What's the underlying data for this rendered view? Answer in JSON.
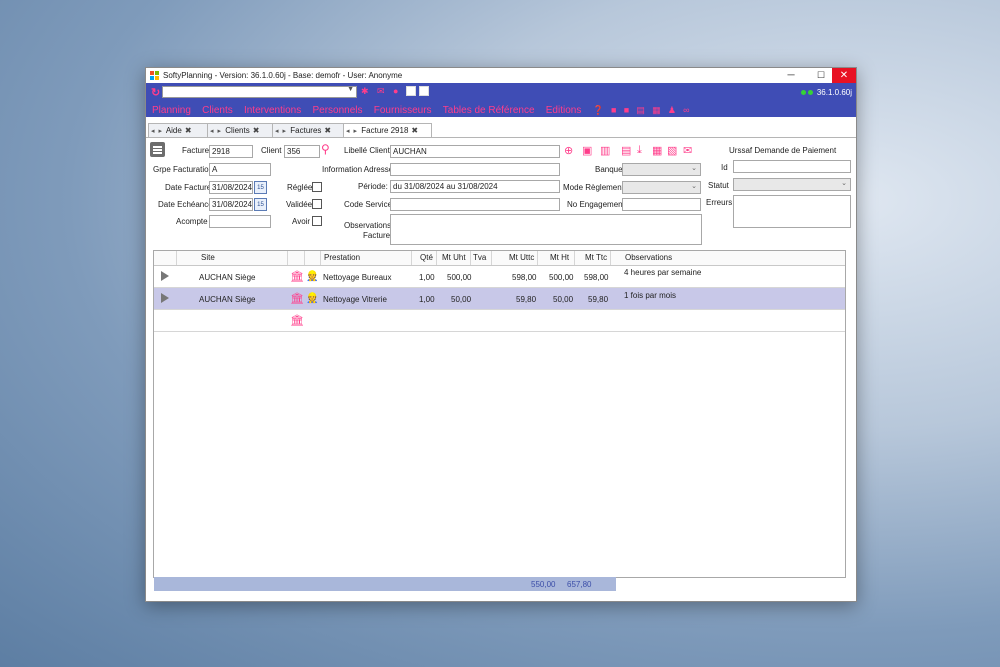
{
  "window": {
    "title": "SoftyPlanning - Version: 36.1.0.60j - Base: demofr - User: Anonyme",
    "min": "─",
    "max": "☐",
    "close": "✕"
  },
  "toolbar": {
    "version": "36.1.0.60j",
    "combo_value": ""
  },
  "menu": {
    "items": [
      "Planning",
      "Clients",
      "Interventions",
      "Personnels",
      "Fournisseurs",
      "Tables de Référence",
      "Editions"
    ]
  },
  "tabs": [
    {
      "label": "Aide"
    },
    {
      "label": "Clients"
    },
    {
      "label": "Factures"
    },
    {
      "label": "Facture 2918"
    }
  ],
  "form": {
    "facture_label": "Facture",
    "facture_value": "2918",
    "client_label": "Client",
    "client_value": "356",
    "libelle_label": "Libellé Client",
    "libelle_value": "AUCHAN",
    "grpe_label": "Grpe Facturation",
    "grpe_value": "A",
    "info_label": "Information Adresse",
    "info_value": "",
    "banque_label": "Banque",
    "date_facture_label": "Date Facture",
    "date_facture_value": "31/08/2024",
    "reglee_label": "Réglée",
    "periode_label": "Période:",
    "periode_value": "du 31/08/2024 au 31/08/2024",
    "mode_label": "Mode Règlement",
    "date_echeance_label": "Date Echéance",
    "date_echeance_value": "31/08/2024",
    "validee_label": "Validée",
    "code_service_label": "Code Service",
    "code_service_value": "",
    "no_engagement_label": "No Engagement",
    "no_engagement_value": "",
    "acompte_label": "Acompte",
    "acompte_value": "",
    "avoir_label": "Avoir",
    "observations_label_1": "Observations",
    "observations_label_2": "Facture",
    "calendar_text": "15"
  },
  "urssaf": {
    "title": "Urssaf Demande de Paiement",
    "id_label": "Id",
    "statut_label": "Statut",
    "erreurs_label": "Erreurs"
  },
  "grid": {
    "columns": [
      "Site",
      "Prestation",
      "Qté",
      "Mt Uht",
      "Tva",
      "Mt Uttc",
      "Mt Ht",
      "Mt Ttc",
      "Observations"
    ],
    "rows": [
      {
        "site": "AUCHAN Siège",
        "prestation": "Nettoyage Bureaux",
        "qte": "1,00",
        "mt_uht": "500,00",
        "tva": "",
        "mt_uttc": "598,00",
        "mt_ht": "500,00",
        "mt_ttc": "598,00",
        "observations": "4 heures par semaine",
        "selected": false
      },
      {
        "site": "AUCHAN Siège",
        "prestation": "Nettoyage Vitrerie",
        "qte": "1,00",
        "mt_uht": "50,00",
        "tva": "",
        "mt_uttc": "59,80",
        "mt_ht": "50,00",
        "mt_ttc": "59,80",
        "observations": "1 fois par mois",
        "selected": true
      }
    ],
    "footer": {
      "total_ht": "550,00",
      "total_ttc": "657,80"
    }
  },
  "colors": {
    "toolbar": "#3f4db5",
    "accent": "#ff3d8b",
    "selected_row": "#c8c8e8"
  }
}
